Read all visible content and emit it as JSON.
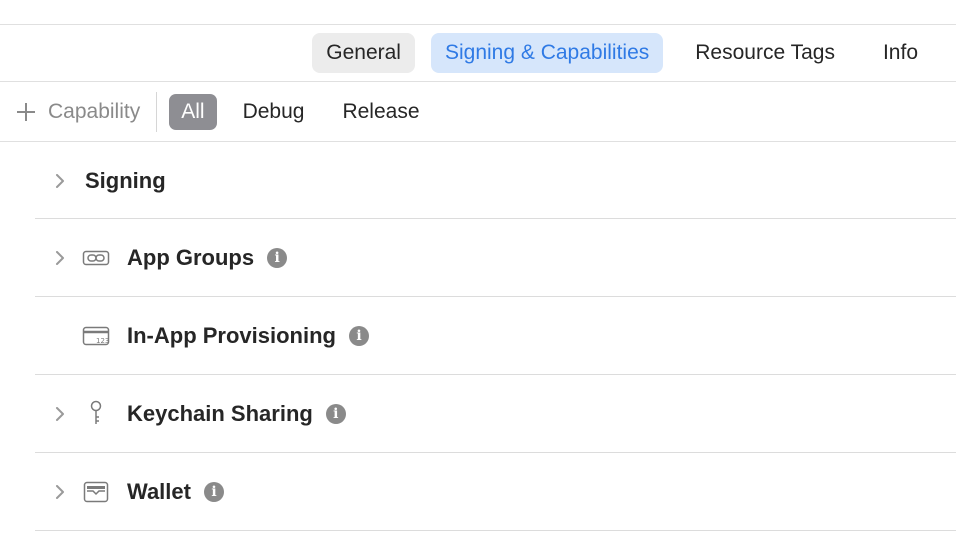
{
  "tabs": [
    {
      "label": "General"
    },
    {
      "label": "Signing & Capabilities",
      "selected": true
    },
    {
      "label": "Resource Tags"
    },
    {
      "label": "Info"
    }
  ],
  "filter": {
    "add_capability_label": "Capability",
    "segments": [
      {
        "label": "All",
        "active": true
      },
      {
        "label": "Debug"
      },
      {
        "label": "Release"
      }
    ]
  },
  "capabilities": [
    {
      "label": "Signing",
      "expandable": true,
      "icon": null,
      "info": false
    },
    {
      "label": "App Groups",
      "expandable": true,
      "icon": "link-icon",
      "info": true
    },
    {
      "label": "In-App Provisioning",
      "expandable": false,
      "icon": "card-icon",
      "info": true
    },
    {
      "label": "Keychain Sharing",
      "expandable": true,
      "icon": "key-icon",
      "info": true
    },
    {
      "label": "Wallet",
      "expandable": true,
      "icon": "wallet-icon",
      "info": true
    }
  ],
  "info_glyph": "i",
  "colors": {
    "accent": "#2f7ae5",
    "selected_tab_bg": "#d6e6fb",
    "segment_active_bg": "#8e8e93"
  }
}
